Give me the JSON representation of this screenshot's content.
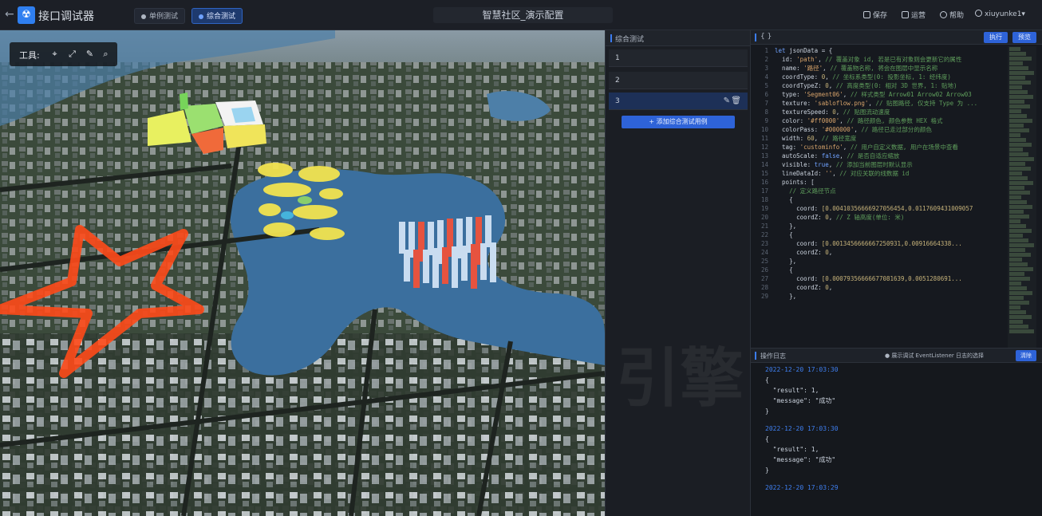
{
  "topbar": {
    "back_icon": "back-arrow-icon",
    "logo_icon": "app-logo-icon",
    "app_title": "接口调试器",
    "tabs": [
      {
        "label": "单例测试",
        "active": false
      },
      {
        "label": "综合测试",
        "active": true
      }
    ],
    "scene_title": "智慧社区_演示配置",
    "actions": [
      {
        "label": "保存",
        "icon": "save-icon"
      },
      {
        "label": "运营",
        "icon": "settings-icon"
      },
      {
        "label": "帮助",
        "icon": "help-icon"
      },
      {
        "label": "xiuyunke1▾",
        "icon": "user-icon"
      }
    ]
  },
  "map": {
    "toolbar_label": "工具:",
    "tools": [
      "locate-icon",
      "fullscreen-icon",
      "pen-icon",
      "search-icon"
    ]
  },
  "caselist": {
    "title": "综合测试",
    "cases": [
      {
        "label": "1",
        "active": false
      },
      {
        "label": "2",
        "active": false
      },
      {
        "label": "3",
        "active": true
      }
    ],
    "add_button": "+ 添加综合测试用例"
  },
  "editor": {
    "header": "{ }",
    "buttons": [
      "执行",
      "预览"
    ],
    "lines": [
      {
        "n": "1",
        "html": "<span class='k'>let</span> <span class='t'>jsonData = {</span>"
      },
      {
        "n": "2",
        "html": "  <span class='t'>id:</span> <span class='s'>'path'</span>, <span class='c'>// 覆盖对象 id, 若是已有对象则会更新它的属性</span>"
      },
      {
        "n": "3",
        "html": "  <span class='t'>name:</span> <span class='s'>'路径'</span>, <span class='c'>// 覆盖物名称, 将会在图层中显示名称</span>"
      },
      {
        "n": "4",
        "html": "  <span class='t'>coordType:</span> <span class='n'>0</span>, <span class='c'>// 坐标系类型(0: 投影坐标, 1: 经纬度)</span>"
      },
      {
        "n": "5",
        "html": "  <span class='t'>coordTypeZ:</span> <span class='n'>0</span>, <span class='c'>// 高度类型(0: 相对 3D 世界, 1: 贴地)</span>"
      },
      {
        "n": "6",
        "html": "  <span class='t'>type:</span> <span class='s'>'Segment06'</span>, <span class='c'>// 样式类型 Arrow01 Arrow02 Arrow03</span>"
      },
      {
        "n": "7",
        "html": "  <span class='t'>texture:</span> <span class='s'>'sabloflow.png'</span>, <span class='c'>// 贴图路径, 仅支持 Type 为 ...</span>"
      },
      {
        "n": "8",
        "html": "  <span class='t'>textureSpeed:</span> <span class='n'>0</span>, <span class='c'>// 贴图流动速度</span>"
      },
      {
        "n": "9",
        "html": "  <span class='t'>color:</span> <span class='s'>'#ff0000'</span>, <span class='c'>// 路径颜色, 颜色参数 HEX 格式</span>"
      },
      {
        "n": "10",
        "html": "  <span class='t'>colorPass:</span> <span class='s'>'#000000'</span>, <span class='c'>// 路径已走过部分的颜色</span>"
      },
      {
        "n": "11",
        "html": "  <span class='t'>width:</span> <span class='n'>60</span>, <span class='c'>// 路径宽度</span>"
      },
      {
        "n": "12",
        "html": "  <span class='t'>tag:</span> <span class='s'>'custominfo'</span>, <span class='c'>// 用户自定义数据, 用户在场景中查看</span>"
      },
      {
        "n": "13",
        "html": "  <span class='t'>autoScale:</span> <span class='k'>false</span>, <span class='c'>// 是否自适应缩放</span>"
      },
      {
        "n": "14",
        "html": "  <span class='t'>visible:</span> <span class='k'>true</span>, <span class='c'>// 添加当前图层时默认显示</span>"
      },
      {
        "n": "15",
        "html": "  <span class='t'>lineDataId:</span> <span class='s'>''</span>, <span class='c'>// 对应关联的线数据 id</span>"
      },
      {
        "n": "16",
        "html": "  <span class='t'>points: [</span>"
      },
      {
        "n": "17",
        "html": "    <span class='c'>// 定义路径节点</span>"
      },
      {
        "n": "18",
        "html": "    <span class='t'>{</span>"
      },
      {
        "n": "19",
        "html": "      <span class='t'>coord:</span> <span class='n'>[0.00410356666927056454,0.0117609431009057</span>"
      },
      {
        "n": "20",
        "html": "      <span class='t'>coordZ:</span> <span class='n'>0</span>, <span class='c'>// Z 轴高度(单位: 米)</span>"
      },
      {
        "n": "21",
        "html": "    <span class='t'>},</span>"
      },
      {
        "n": "22",
        "html": "    <span class='t'>{</span>"
      },
      {
        "n": "23",
        "html": "      <span class='t'>coord:</span> <span class='n'>[0.0013456666667250931,0.00916664338...</span>"
      },
      {
        "n": "24",
        "html": "      <span class='t'>coordZ:</span> <span class='n'>0</span>,"
      },
      {
        "n": "25",
        "html": "    <span class='t'>},</span>"
      },
      {
        "n": "26",
        "html": "    <span class='t'>{</span>"
      },
      {
        "n": "27",
        "html": "      <span class='t'>coord:</span> <span class='n'>[0.00079356666677081639,0.0051280691...</span>"
      },
      {
        "n": "28",
        "html": "      <span class='t'>coordZ:</span> <span class='n'>0</span>,"
      },
      {
        "n": "29",
        "html": "    <span class='t'>},</span>"
      }
    ]
  },
  "log": {
    "title": "操作日志",
    "hint": "● 展示调试 EventListener 日志的选择",
    "clear_label": "清除",
    "entries": [
      {
        "time": "2022-12-20 17:03:30",
        "lines": [
          "{",
          "  \"result\": 1,",
          "  \"message\": \"成功\"",
          "}"
        ]
      },
      {
        "time": "2022-12-20 17:03:30",
        "lines": [
          "{",
          "  \"result\": 1,",
          "  \"message\": \"成功\"",
          "}"
        ]
      },
      {
        "time": "2022-12-20 17:03:29",
        "lines": []
      }
    ]
  },
  "watermark": "引擎",
  "colors": {
    "accent": "#2e63d8",
    "water": "#3b6f9e",
    "path_star": "#ff4a1a",
    "bar_red": "#e6533f",
    "bar_light": "#c9dcf0"
  }
}
